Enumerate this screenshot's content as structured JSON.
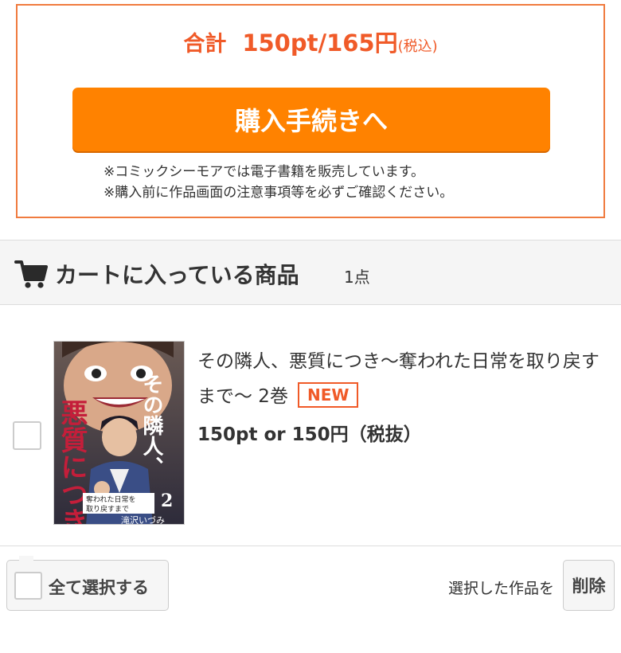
{
  "summary": {
    "total_label": "合計",
    "total_amount": "150pt/165円",
    "tax_note": "(税込)",
    "checkout_label": "購入手続きへ",
    "notes": [
      "※コミックシーモアでは電子書籍を販売しています。",
      "※購入前に作品画面の注意事項等を必ずご確認ください。"
    ]
  },
  "cart": {
    "title": "カートに入っている商品",
    "count": "1点"
  },
  "item": {
    "title": "その隣人、悪質につき〜奪われた日常を取り戻すまで〜 2巻",
    "badge": "NEW",
    "price": "150pt or 150円（税抜）",
    "cover": {
      "title_line1": "その隣人、",
      "title_line2": "悪質につき",
      "subtitle_a": "奪われた日常を",
      "subtitle_b": "取り戻すまで",
      "volume": "2",
      "author": "滝沢いづみ"
    }
  },
  "bottom": {
    "select_all_label": "全て選択する",
    "selected_text": "選択した作品を",
    "delete_label": "削除"
  },
  "colors": {
    "accent": "#f05a28",
    "button": "#ff8200"
  }
}
